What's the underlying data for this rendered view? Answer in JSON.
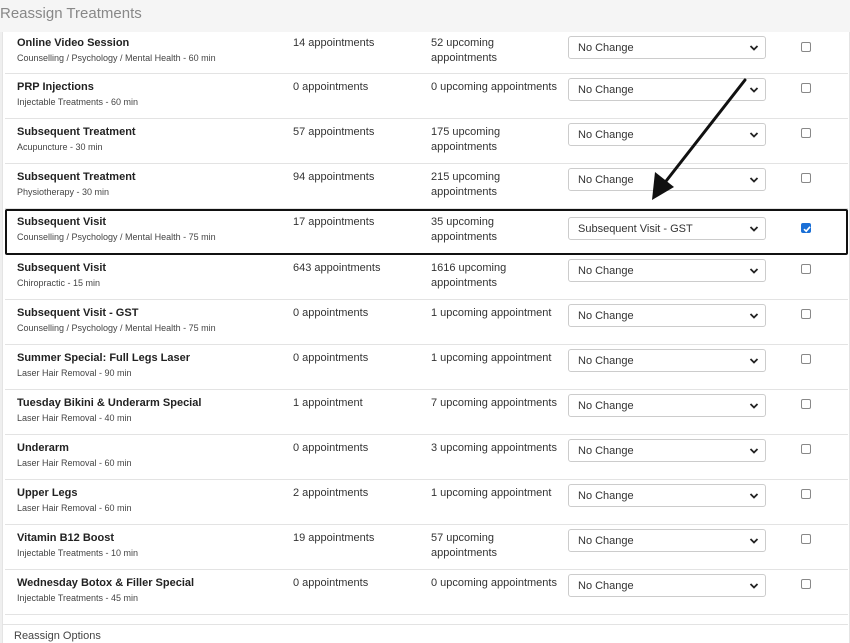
{
  "header": {
    "title": "Reassign Treatments"
  },
  "rows": [
    {
      "name": "Online Video Session",
      "category": "Counselling / Psychology / Mental Health - 60 min",
      "appointments": "14 appointments",
      "upcoming": "52 upcoming appointments",
      "reassign": "No Change",
      "checked": false
    },
    {
      "name": "PRP Injections",
      "category": "Injectable Treatments - 60 min",
      "appointments": "0 appointments",
      "upcoming": "0 upcoming appointments",
      "reassign": "No Change",
      "checked": false
    },
    {
      "name": "Subsequent Treatment",
      "category": "Acupuncture - 30 min",
      "appointments": "57 appointments",
      "upcoming": "175 upcoming appointments",
      "reassign": "No Change",
      "checked": false
    },
    {
      "name": "Subsequent Treatment",
      "category": "Physiotherapy - 30 min",
      "appointments": "94 appointments",
      "upcoming": "215 upcoming appointments",
      "reassign": "No Change",
      "checked": false
    },
    {
      "name": "Subsequent Visit",
      "category": "Counselling / Psychology / Mental Health - 75 min",
      "appointments": "17 appointments",
      "upcoming": "35 upcoming appointments",
      "reassign": "Subsequent Visit - GST",
      "checked": true
    },
    {
      "name": "Subsequent Visit",
      "category": "Chiropractic - 15 min",
      "appointments": "643 appointments",
      "upcoming": "1616 upcoming appointments",
      "reassign": "No Change",
      "checked": false
    },
    {
      "name": "Subsequent Visit - GST",
      "category": "Counselling / Psychology / Mental Health - 75 min",
      "appointments": "0 appointments",
      "upcoming": "1 upcoming appointment",
      "reassign": "No Change",
      "checked": false
    },
    {
      "name": "Summer Special: Full Legs Laser",
      "category": "Laser Hair Removal - 90 min",
      "appointments": "0 appointments",
      "upcoming": "1 upcoming appointment",
      "reassign": "No Change",
      "checked": false
    },
    {
      "name": "Tuesday Bikini & Underarm Special",
      "category": "Laser Hair Removal - 40 min",
      "appointments": "1 appointment",
      "upcoming": "7 upcoming appointments",
      "reassign": "No Change",
      "checked": false
    },
    {
      "name": "Underarm",
      "category": "Laser Hair Removal - 60 min",
      "appointments": "0 appointments",
      "upcoming": "3 upcoming appointments",
      "reassign": "No Change",
      "checked": false
    },
    {
      "name": "Upper Legs",
      "category": "Laser Hair Removal - 60 min",
      "appointments": "2 appointments",
      "upcoming": "1 upcoming appointment",
      "reassign": "No Change",
      "checked": false
    },
    {
      "name": "Vitamin B12 Boost",
      "category": "Injectable Treatments - 10 min",
      "appointments": "19 appointments",
      "upcoming": "57 upcoming appointments",
      "reassign": "No Change",
      "checked": false
    },
    {
      "name": "Wednesday Botox & Filler Special",
      "category": "Injectable Treatments - 45 min",
      "appointments": "0 appointments",
      "upcoming": "0 upcoming appointments",
      "reassign": "No Change",
      "checked": false
    }
  ],
  "footer": {
    "label": "Reassign Options"
  },
  "icons": {
    "select": "chevron-down-icon",
    "check": "check-icon",
    "annotation": "arrow-icon"
  },
  "colors": {
    "checkbox_checked": "#1a6fd6",
    "highlight_border": "#111111"
  }
}
